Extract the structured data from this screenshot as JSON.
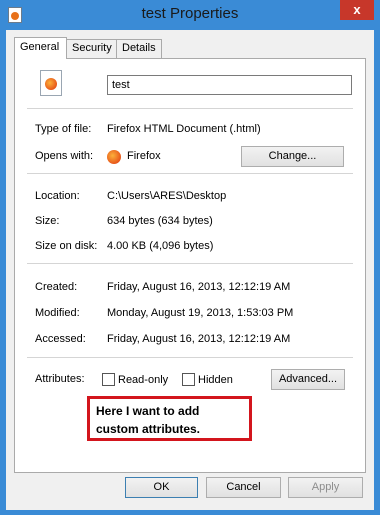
{
  "window": {
    "title": "test Properties",
    "close_glyph": "x"
  },
  "tabs": [
    {
      "label": "General"
    },
    {
      "label": "Security"
    },
    {
      "label": "Details"
    }
  ],
  "general": {
    "file_name": "test",
    "type_of_file_label": "Type of file:",
    "type_of_file_value": "Firefox HTML Document (.html)",
    "opens_with_label": "Opens with:",
    "opens_with_value": "Firefox",
    "change_button": "Change...",
    "location_label": "Location:",
    "location_value": "C:\\Users\\ARES\\Desktop",
    "size_label": "Size:",
    "size_value": "634 bytes (634 bytes)",
    "size_on_disk_label": "Size on disk:",
    "size_on_disk_value": "4.00 KB (4,096 bytes)",
    "created_label": "Created:",
    "created_value": "Friday, August 16, 2013, 12:12:19 AM",
    "modified_label": "Modified:",
    "modified_value": "Monday, August 19, 2013, 1:53:03 PM",
    "accessed_label": "Accessed:",
    "accessed_value": "Friday, August 16, 2013, 12:12:19 AM",
    "attributes_label": "Attributes:",
    "readonly_label": "Read-only",
    "readonly_checked": false,
    "hidden_label": "Hidden",
    "hidden_checked": false,
    "advanced_button": "Advanced..."
  },
  "annotation": {
    "text": "Here I want to add custom attributes."
  },
  "footer": {
    "ok": "OK",
    "cancel": "Cancel",
    "apply": "Apply"
  },
  "colors": {
    "titlebar": "#3a8bd6",
    "close_button": "#c7372a",
    "annotation_border": "#d3151d"
  }
}
